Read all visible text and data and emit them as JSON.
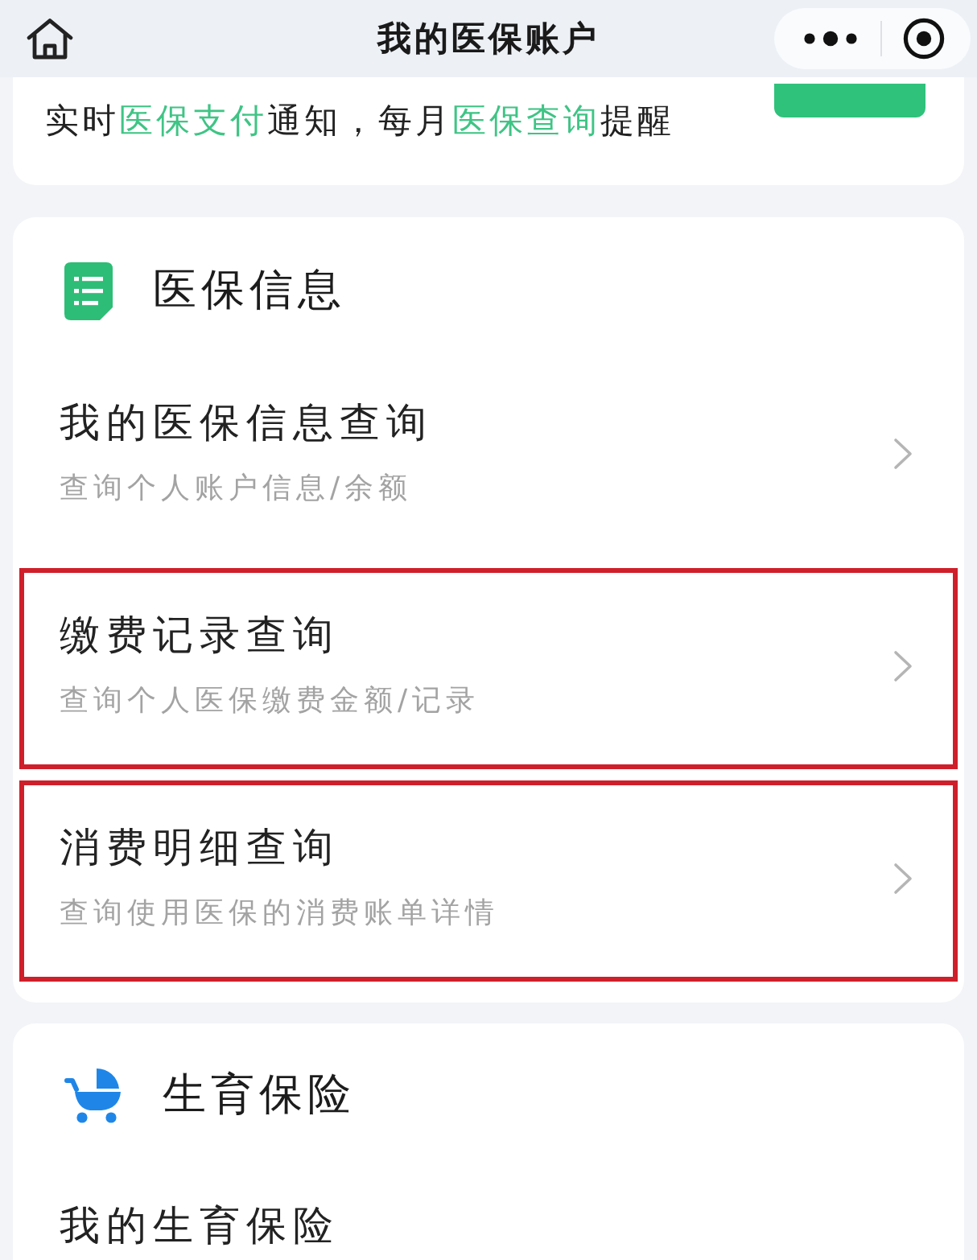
{
  "header": {
    "title": "我的医保账户"
  },
  "notice": {
    "segments": [
      {
        "text": "实时",
        "accent": false
      },
      {
        "text": "医保支付",
        "accent": true
      },
      {
        "text": "通知，每月",
        "accent": false
      },
      {
        "text": "医保查询",
        "accent": true
      },
      {
        "text": "提醒",
        "accent": false
      }
    ],
    "action_button": {
      "shown": true
    }
  },
  "sections": [
    {
      "kind": "info",
      "title": "医保信息",
      "items": [
        {
          "title": "我的医保信息查询",
          "subtitle": "查询个人账户信息/余额",
          "arrow": true,
          "highlighted": false
        },
        {
          "title": "缴费记录查询",
          "subtitle": "查询个人医保缴费金额/记录",
          "arrow": true,
          "highlighted": true
        },
        {
          "title": "消费明细查询",
          "subtitle": "查询使用医保的消费账单详情",
          "arrow": true,
          "highlighted": true
        }
      ]
    },
    {
      "kind": "maternity",
      "title": "生育保险",
      "items": [
        {
          "title": "我的生育保险",
          "arrow": false,
          "highlighted": false
        }
      ]
    }
  ]
}
